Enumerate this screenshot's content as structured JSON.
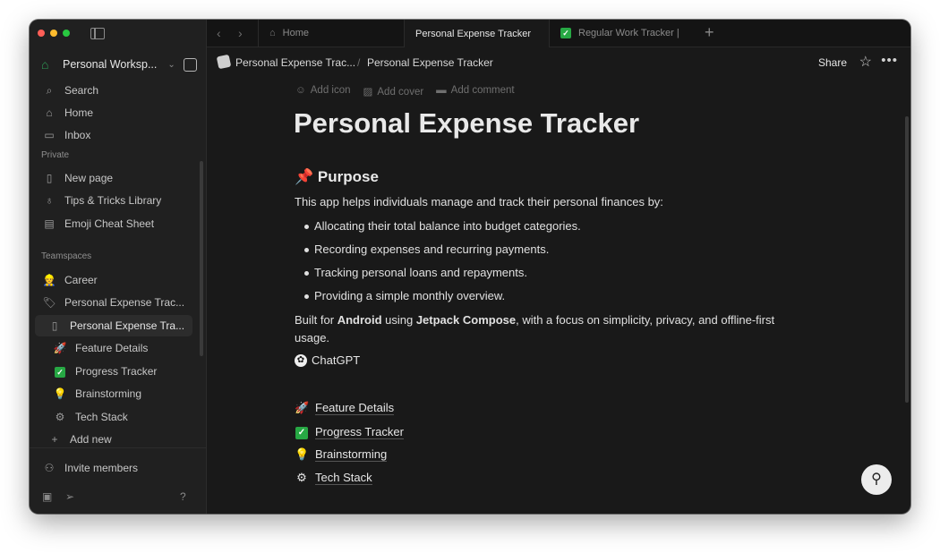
{
  "colors": {
    "accent_green": "#27a844",
    "window_bg": "#191919",
    "sidebar_bg": "#202020"
  },
  "sidebar": {
    "workspace_name": "Personal Worksp...",
    "nav": [
      {
        "label": "Search",
        "icon": "search-icon"
      },
      {
        "label": "Home",
        "icon": "home-icon"
      },
      {
        "label": "Inbox",
        "icon": "inbox-icon"
      }
    ],
    "private_label": "Private",
    "private_items": [
      {
        "label": "New page",
        "icon": "page-icon"
      },
      {
        "label": "Tips & Tricks Library",
        "icon": "bulb-icon"
      },
      {
        "label": "Emoji Cheat Sheet",
        "icon": "book-icon"
      }
    ],
    "teamspaces_label": "Teamspaces",
    "team_items": [
      {
        "label": "Career",
        "icon": "person-emoji"
      },
      {
        "label": "Personal Expense Trac...",
        "icon": "money-tag-emoji"
      },
      {
        "label": "Personal Expense Tra...",
        "icon": "page-icon"
      },
      {
        "label": "Feature Details",
        "icon": "rocket-emoji"
      },
      {
        "label": "Progress Tracker",
        "icon": "check-emoji"
      },
      {
        "label": "Brainstorming",
        "icon": "bulb-emoji"
      },
      {
        "label": "Tech Stack",
        "icon": "gear-emoji"
      },
      {
        "label": "Add new",
        "icon": "plus-icon"
      }
    ],
    "invite": "Invite members"
  },
  "tabs": [
    {
      "label": "Home",
      "icon": "home-icon"
    },
    {
      "label": "Personal Expense Tracker",
      "icon": ""
    },
    {
      "label": "Regular Work Tracker |",
      "icon": "check-emoji"
    }
  ],
  "breadcrumb": {
    "parent": "Personal Expense Trac...",
    "current": "Personal Expense Tracker"
  },
  "topbar": {
    "share": "Share"
  },
  "page_actions": {
    "add_icon": "Add icon",
    "add_cover": "Add cover",
    "add_comment": "Add comment"
  },
  "page": {
    "title": "Personal Expense Tracker",
    "purpose_heading": "Purpose",
    "intro": "This app helps individuals manage and track their personal finances by:",
    "bullets": [
      "Allocating their total balance into budget categories.",
      "Recording expenses and recurring payments.",
      "Tracking personal loans and repayments.",
      "Providing a simple monthly overview."
    ],
    "built_for": {
      "pre": "Built for ",
      "b1": "Android",
      "mid": " using ",
      "b2": "Jetpack Compose",
      "post": ", with a focus on simplicity, privacy, and offline-first usage."
    },
    "chatgpt_link": "ChatGPT",
    "subpages": [
      {
        "label": "Feature Details",
        "icon": "rocket-emoji"
      },
      {
        "label": "Progress Tracker",
        "icon": "check-emoji"
      },
      {
        "label": "Brainstorming",
        "icon": "bulb-emoji"
      },
      {
        "label": "Tech Stack",
        "icon": "gear-emoji"
      }
    ]
  }
}
